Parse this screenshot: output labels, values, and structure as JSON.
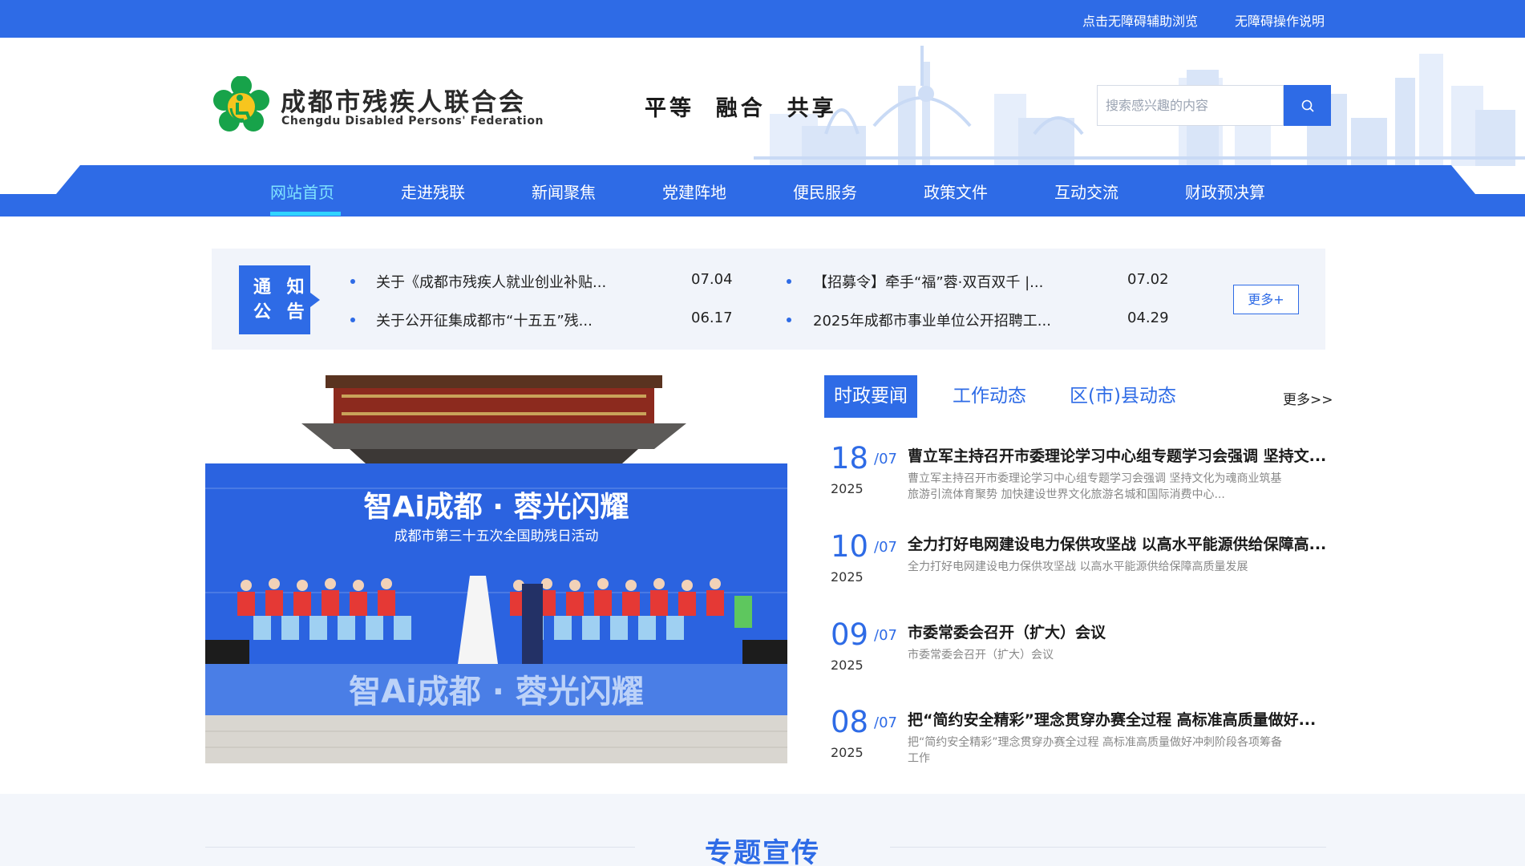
{
  "topbar": {
    "accessible_browse": "点击无障碍辅助浏览",
    "accessible_guide": "无障碍操作说明"
  },
  "header": {
    "org_name_cn": "成都市残疾人联合会",
    "org_name_en": "Chengdu Disabled Persons' Federation",
    "slogan": "平等  融合  共享",
    "search_placeholder": "搜索感兴趣的内容"
  },
  "nav": {
    "items": [
      "网站首页",
      "走进残联",
      "新闻聚焦",
      "党建阵地",
      "便民服务",
      "政策文件",
      "互动交流",
      "财政预决算"
    ],
    "active_index": 0
  },
  "notice": {
    "badge_line1": "通 知",
    "badge_line2": "公 告",
    "items": [
      {
        "title": "关于《成都市残疾人就业创业补贴...",
        "date": "07.04"
      },
      {
        "title": "【招募令】牵手“福”蓉·双百双千 |...",
        "date": "07.02"
      },
      {
        "title": "关于公开征集成都市“十五五”残...",
        "date": "06.17"
      },
      {
        "title": "2025年成都市事业单位公开招聘工...",
        "date": "04.29"
      }
    ],
    "more_label": "更多+"
  },
  "photo": {
    "headline": "智Ai成都 · 蓉光闪耀",
    "subline": "成都市第三十五次全国助残日活动",
    "floor_text": "智Ai成都 · 蓉光闪耀"
  },
  "news": {
    "tabs": [
      "时政要闻",
      "工作动态",
      "区(市)县动态"
    ],
    "active_tab": 0,
    "more_label": "更多>>",
    "items": [
      {
        "day": "18",
        "month": "/07",
        "year": "2025",
        "title": "曹立军主持召开市委理论学习中心组专题学习会强调 坚持文...",
        "summary": "曹立军主持召开市委理论学习中心组专题学习会强调 坚持文化为魂商业筑基旅游引流体育聚势 加快建设世界文化旅游名城和国际消费中心..."
      },
      {
        "day": "10",
        "month": "/07",
        "year": "2025",
        "title": "全力打好电网建设电力保供攻坚战 以高水平能源供给保障高...",
        "summary": "全力打好电网建设电力保供攻坚战 以高水平能源供给保障高质量发展"
      },
      {
        "day": "09",
        "month": "/07",
        "year": "2025",
        "title": "市委常委会召开（扩大）会议",
        "summary": "市委常委会召开（扩大）会议"
      },
      {
        "day": "08",
        "month": "/07",
        "year": "2025",
        "title": "把“简约安全精彩”理念贯穿办赛全过程 高标准高质量做好...",
        "summary": "把“简约安全精彩”理念贯穿办赛全过程 高标准高质量做好冲刺阶段各项筹备工作"
      }
    ]
  },
  "bottom": {
    "section_title": "专题宣传"
  },
  "colors": {
    "primary": "#2e6be6",
    "nav_active": "#7fe3ff",
    "underline": "#2fd4ff"
  }
}
